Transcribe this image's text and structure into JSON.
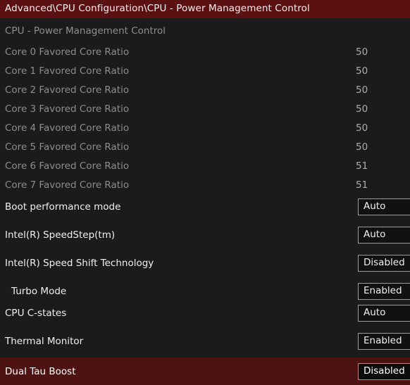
{
  "titlebar": {
    "breadcrumb": "Advanced\\CPU Configuration\\CPU - Power Management Control"
  },
  "section": {
    "heading": "CPU - Power Management Control"
  },
  "colors": {
    "titlebar_bg": "#5b1111",
    "page_bg": "#1b1b1b",
    "selected_row_bg": "#4d1313",
    "box_border": "#9b9b9b",
    "box_bg": "#111111",
    "label_active": "#f0f0f0",
    "label_dim": "#8d8d8d",
    "value_dim": "#adadad"
  },
  "info_rows": [
    {
      "label": "Core 0 Favored Core Ratio",
      "value": "50"
    },
    {
      "label": "Core 1 Favored Core Ratio",
      "value": "50"
    },
    {
      "label": "Core 2 Favored Core Ratio",
      "value": "50"
    },
    {
      "label": "Core 3 Favored Core Ratio",
      "value": "50"
    },
    {
      "label": "Core 4 Favored Core Ratio",
      "value": "50"
    },
    {
      "label": "Core 5 Favored Core Ratio",
      "value": "50"
    },
    {
      "label": "Core 6 Favored Core Ratio",
      "value": "51"
    },
    {
      "label": "Core 7 Favored Core Ratio",
      "value": "51"
    }
  ],
  "option_rows": [
    {
      "label": "Boot performance mode",
      "value": "Auto",
      "indent": false
    },
    {
      "label": "Intel(R) SpeedStep(tm)",
      "value": "Auto",
      "indent": false
    },
    {
      "label": "Intel(R) Speed Shift Technology",
      "value": "Disabled",
      "indent": false
    },
    {
      "label": "Turbo Mode",
      "value": "Enabled",
      "indent": true
    },
    {
      "label": "CPU C-states",
      "value": "Auto",
      "indent": false
    },
    {
      "label": "Thermal Monitor",
      "value": "Enabled",
      "indent": false
    }
  ],
  "selected_row": {
    "label": "Dual Tau Boost",
    "value": "Disabled"
  }
}
